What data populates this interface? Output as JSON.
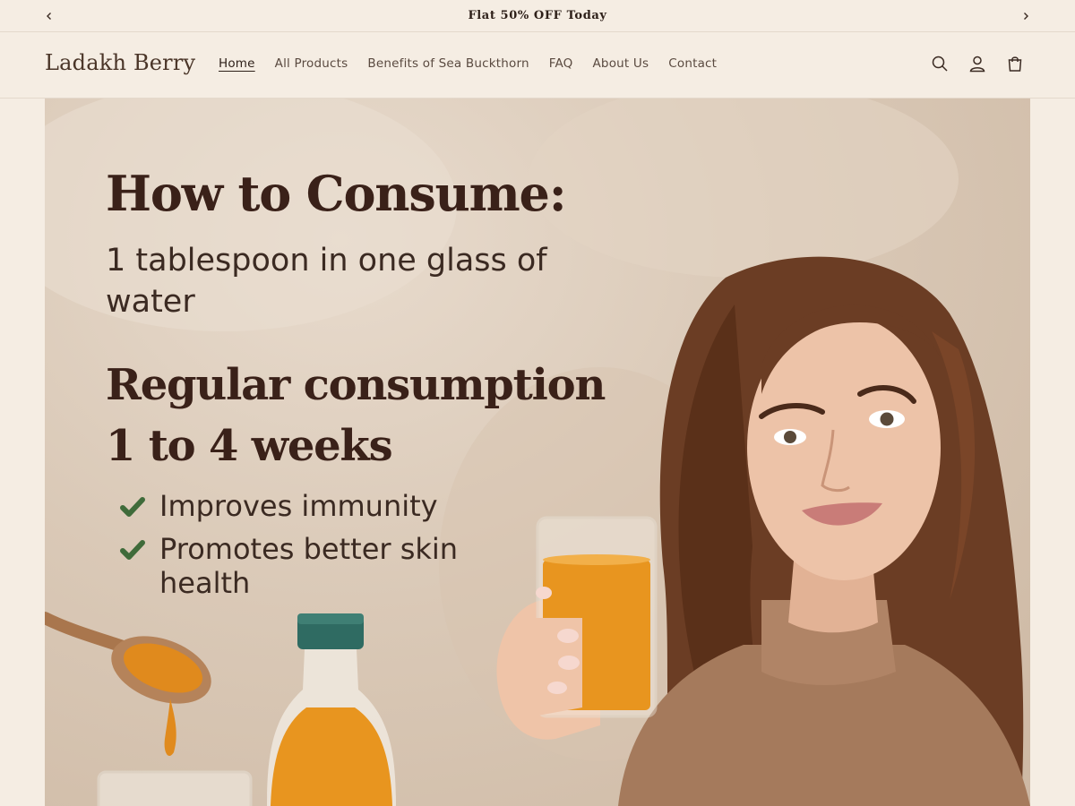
{
  "announcement": {
    "text": "Flat 50% OFF Today",
    "prev_icon": "chevron-left-icon",
    "next_icon": "chevron-right-icon"
  },
  "header": {
    "logo": "Ladakh Berry",
    "nav": [
      {
        "label": "Home",
        "active": true
      },
      {
        "label": "All Products"
      },
      {
        "label": "Benefits of Sea Buckthorn"
      },
      {
        "label": "FAQ"
      },
      {
        "label": "About Us"
      },
      {
        "label": "Contact"
      }
    ],
    "icons": [
      "search-icon",
      "account-icon",
      "cart-icon"
    ]
  },
  "hero": {
    "title": "How to Consume:",
    "subtitle": "1 tablespoon in one glass of water",
    "title2_line1": "Regular consumption",
    "title2_line2": "1 to 4 weeks",
    "benefits": [
      "Improves immunity",
      "Promotes better skin health"
    ],
    "colors": {
      "juice": "#e8951f",
      "cap": "#2f6b62",
      "check": "#3f6b3a",
      "heading": "#3a2119"
    }
  }
}
